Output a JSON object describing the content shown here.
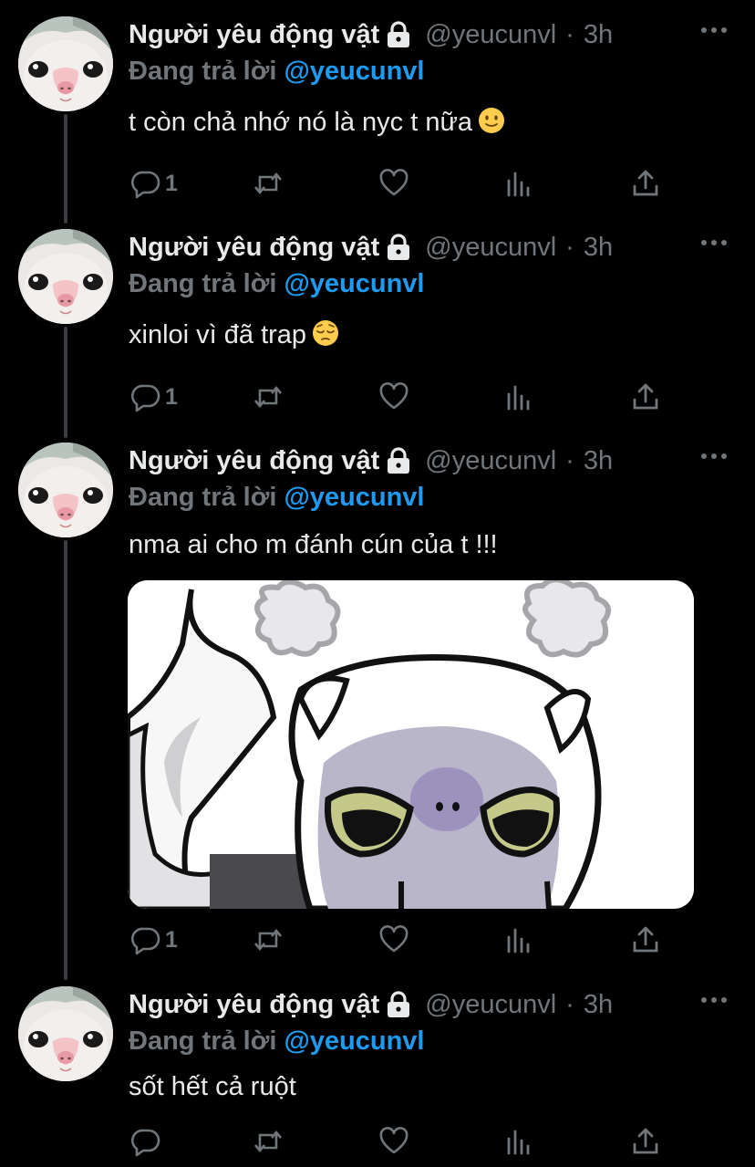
{
  "colors": {
    "background": "#000000",
    "text": "#e7e9ea",
    "muted": "#71767b",
    "accent": "#1d9bf0",
    "thread_line": "#3a3d42"
  },
  "icons": {
    "lock": "lock-icon",
    "more": "more-horizontal-icon",
    "reply": "reply-bubble-icon",
    "retweet": "retweet-arrows-icon",
    "like": "heart-icon",
    "views": "bar-chart-icon",
    "share": "share-upload-icon"
  },
  "tweets": [
    {
      "display_name": "Người yêu động vật",
      "handle": "@yeucunvl",
      "separator": "·",
      "time": "3h",
      "reply_prefix": "Đang trả lời",
      "reply_handle": "@yeucunvl",
      "text": "t còn chả nhớ nó là nyc t nữa",
      "emoji": "slightly-smiling-face",
      "reply_count": "1"
    },
    {
      "display_name": "Người yêu động vật",
      "handle": "@yeucunvl",
      "separator": "·",
      "time": "3h",
      "reply_prefix": "Đang trả lời",
      "reply_handle": "@yeucunvl",
      "text": "xinloi vì đã trap",
      "emoji": "pensive-face",
      "reply_count": "1"
    },
    {
      "display_name": "Người yêu động vật",
      "handle": "@yeucunvl",
      "separator": "·",
      "time": "3h",
      "reply_prefix": "Đang trả lời",
      "reply_handle": "@yeucunvl",
      "text": "nma ai cho m đánh cún của t !!!",
      "media": "angry-cartoon-creature",
      "reply_count": "1"
    },
    {
      "display_name": "Người yêu động vật",
      "handle": "@yeucunvl",
      "separator": "·",
      "time": "3h",
      "reply_prefix": "Đang trả lời",
      "reply_handle": "@yeucunvl",
      "text": "sốt hết cả ruột",
      "reply_count": ""
    }
  ]
}
